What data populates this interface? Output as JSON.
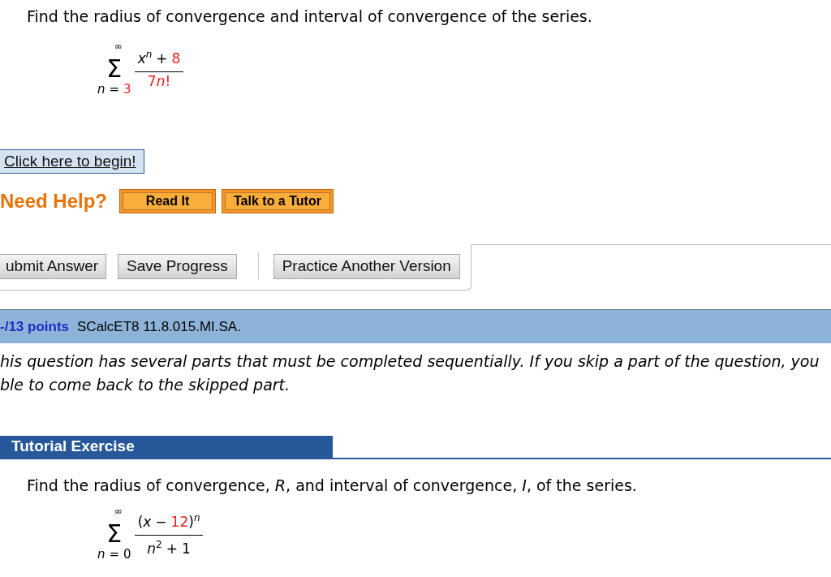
{
  "question": {
    "prompt": "Find the radius of convergence and interval of convergence of the series.",
    "series": {
      "upper": "∞",
      "symbol": "Σ",
      "lower": [
        {
          "text": "n",
          "kind": "var",
          "highlighted": false
        },
        {
          "text": "=",
          "kind": "op",
          "highlighted": false
        },
        {
          "text": "3",
          "kind": "num",
          "highlighted": true
        }
      ],
      "numerator": [
        {
          "text": "x",
          "kind": "var",
          "highlighted": false
        },
        {
          "text": "n",
          "kind": "sup_var",
          "highlighted": false
        },
        {
          "text": "+",
          "kind": "op",
          "highlighted": false
        },
        {
          "text": "8",
          "kind": "num",
          "highlighted": true
        }
      ],
      "denominator": [
        {
          "text": "7",
          "kind": "num",
          "highlighted": true
        },
        {
          "text": "n",
          "kind": "var",
          "highlighted": true
        },
        {
          "text": "!",
          "kind": "num",
          "highlighted": true
        }
      ]
    }
  },
  "begin_button": "Click here to begin!",
  "help": {
    "label": "Need Help?",
    "buttons": [
      "Read It",
      "Talk to a Tutor"
    ]
  },
  "action_groups": [
    [
      "ubmit Answer",
      "Save Progress"
    ],
    [
      "Practice Another Version"
    ]
  ],
  "question_header": {
    "points": "-/13 points",
    "code": "SCalcET8 11.8.015.MI.SA."
  },
  "notice_lines": [
    "his question has several parts that must be completed sequentially. If you skip a part of the question, you",
    "ble to come back to the skipped part."
  ],
  "tutorial": {
    "title": "Tutorial Exercise",
    "prompt": "Find the radius of convergence, *R*, and interval of convergence, *I*, of the series.",
    "series": {
      "upper": "∞",
      "symbol": "Σ",
      "lower": [
        {
          "text": "n",
          "kind": "var",
          "highlighted": false
        },
        {
          "text": "=",
          "kind": "op",
          "highlighted": false
        },
        {
          "text": "0",
          "kind": "num",
          "highlighted": false
        }
      ],
      "numerator": [
        {
          "text": "(",
          "kind": "num",
          "highlighted": false
        },
        {
          "text": "x",
          "kind": "var",
          "highlighted": false
        },
        {
          "text": "−",
          "kind": "op",
          "highlighted": false
        },
        {
          "text": "12",
          "kind": "num",
          "highlighted": true
        },
        {
          "text": ")",
          "kind": "num",
          "highlighted": false
        },
        {
          "text": "n",
          "kind": "sup_var",
          "highlighted": false
        }
      ],
      "denominator": [
        {
          "text": "n",
          "kind": "var",
          "highlighted": false
        },
        {
          "text": "2",
          "kind": "sup_num",
          "highlighted": false
        },
        {
          "text": "+",
          "kind": "op",
          "highlighted": false
        },
        {
          "text": "1",
          "kind": "num",
          "highlighted": false
        }
      ]
    }
  }
}
